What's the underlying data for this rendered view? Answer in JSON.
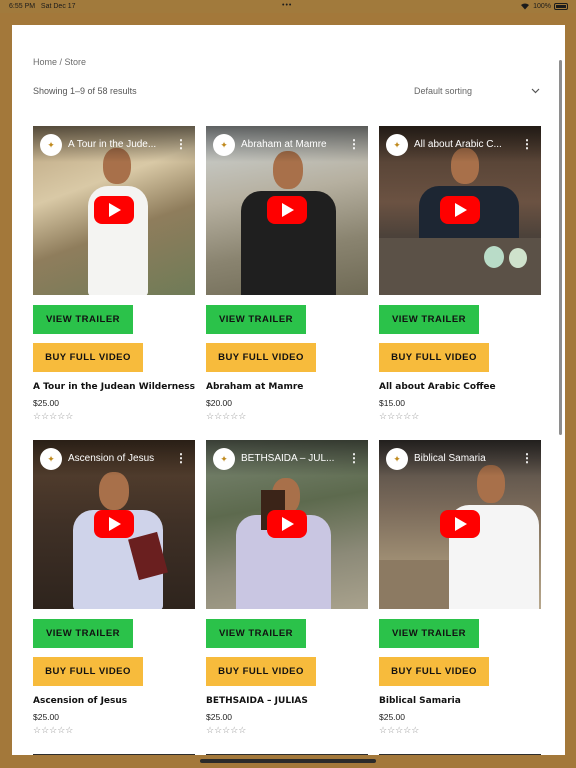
{
  "status_bar": {
    "time": "6:55 PM",
    "date": "Sat Dec 17",
    "dots": "•••",
    "battery": "100%"
  },
  "breadcrumb": {
    "home": "Home",
    "separator": " / ",
    "current": "Store"
  },
  "result_count": "Showing 1–9 of 58 results",
  "sort": {
    "selected": "Default sorting",
    "chevron": "⌄"
  },
  "buttons": {
    "trailer": "VIEW TRAILER",
    "buy": "BUY FULL VIDEO"
  },
  "stars": "☆☆☆☆☆",
  "products": [
    {
      "name": "A Tour in the Judean Wilderness",
      "video_title": "A Tour in the Jude...",
      "price": "$25.00"
    },
    {
      "name": "Abraham at Mamre",
      "video_title": "Abraham at Mamre",
      "price": "$20.00"
    },
    {
      "name": "All about Arabic Coffee",
      "video_title": "All about Arabic C...",
      "price": "$15.00"
    },
    {
      "name": "Ascension of Jesus",
      "video_title": "Ascension of Jesus",
      "price": "$25.00"
    },
    {
      "name": "BETHSAIDA – JULIAS",
      "video_title": "BETHSAIDA – JUL...",
      "price": "$25.00"
    },
    {
      "name": "Biblical Samaria",
      "video_title": "Biblical Samaria",
      "price": "$25.00"
    }
  ],
  "colors": {
    "trailer": "#2bc24a",
    "buy": "#f7bb3c",
    "frame": "#a3783a",
    "play": "#ff0000"
  }
}
